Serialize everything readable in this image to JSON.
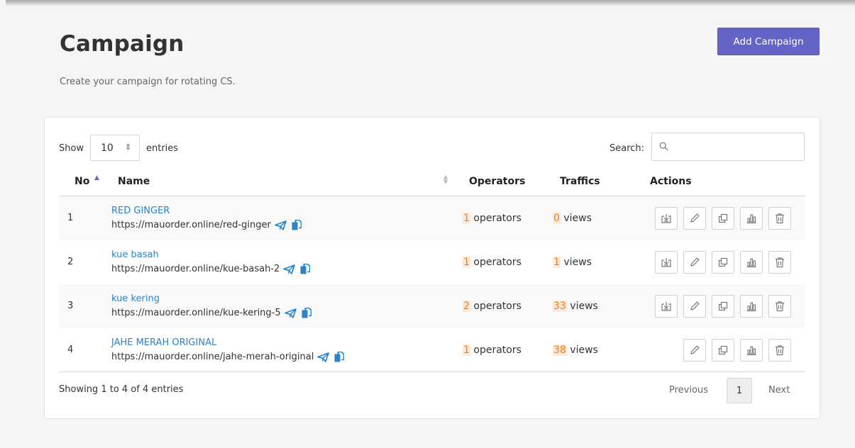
{
  "header": {
    "title": "Campaign",
    "subtitle": "Create your campaign for rotating CS.",
    "add_button": "Add Campaign"
  },
  "controls": {
    "show_label": "Show",
    "entries_value": "10",
    "entries_label": "entries",
    "search_label": "Search:",
    "search_value": ""
  },
  "table": {
    "columns": [
      "No",
      "Name",
      "Operators",
      "Traffics",
      "Actions"
    ],
    "rows": [
      {
        "no": "1",
        "name": "RED GINGER",
        "url": "https://mauorder.online/red-ginger",
        "operators_count": "1",
        "operators_label": "operators",
        "traffic_count": "0",
        "traffic_label": "views",
        "actions": [
          "download",
          "edit",
          "duplicate",
          "stats",
          "delete"
        ]
      },
      {
        "no": "2",
        "name": "kue basah",
        "url": "https://mauorder.online/kue-basah-2",
        "operators_count": "1",
        "operators_label": "operators",
        "traffic_count": "1",
        "traffic_label": "views",
        "actions": [
          "download",
          "edit",
          "duplicate",
          "stats",
          "delete"
        ]
      },
      {
        "no": "3",
        "name": "kue kering",
        "url": "https://mauorder.online/kue-kering-5",
        "operators_count": "2",
        "operators_label": "operators",
        "traffic_count": "33",
        "traffic_label": "views",
        "actions": [
          "download",
          "edit",
          "duplicate",
          "stats",
          "delete"
        ]
      },
      {
        "no": "4",
        "name": "JAHE MERAH ORIGINAL",
        "url": "https://mauorder.online/jahe-merah-original",
        "operators_count": "1",
        "operators_label": "operators",
        "traffic_count": "38",
        "traffic_label": "views",
        "actions": [
          "edit",
          "duplicate",
          "stats",
          "delete"
        ]
      }
    ],
    "sorted_column": "No",
    "sort_direction": "ascending"
  },
  "footer": {
    "info": "Showing 1 to 4 of 4 entries",
    "previous": "Previous",
    "current_page": "1",
    "next": "Next"
  },
  "colors": {
    "primary": "#6364c6",
    "link": "#2d83c5",
    "highlight_bg": "#fde9d9",
    "highlight_text": "#ef7b22"
  },
  "icons": {
    "url_icons": [
      "send-icon",
      "copy-icon"
    ],
    "action_icons": {
      "download": "download-icon",
      "edit": "pencil-icon",
      "duplicate": "duplicate-icon",
      "stats": "bar-chart-icon",
      "delete": "trash-icon"
    },
    "search": "search-icon"
  }
}
